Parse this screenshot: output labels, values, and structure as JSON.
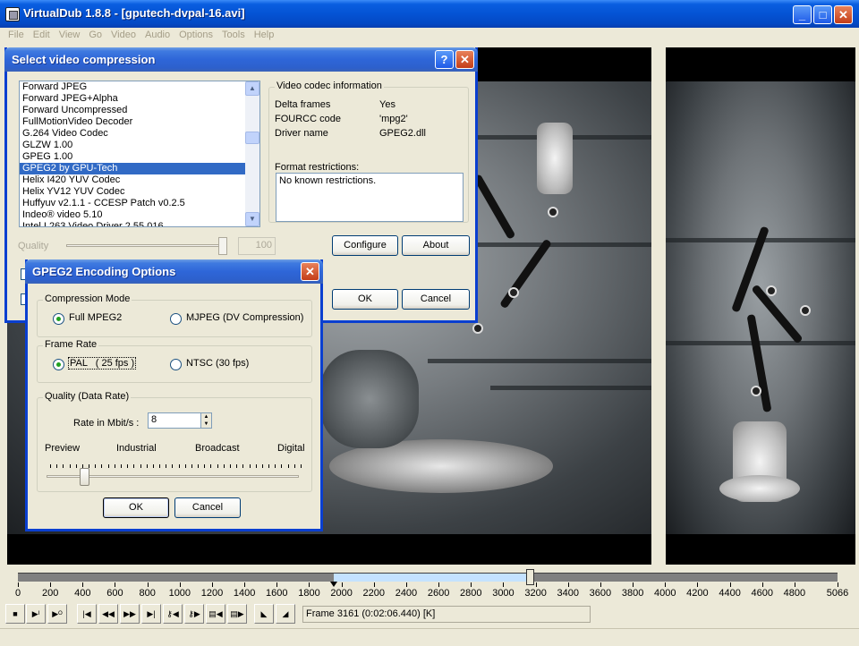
{
  "main_window": {
    "title": "VirtualDub 1.8.8 - [gputech-dvpal-16.avi]",
    "buttons": {
      "minimize": "_",
      "maximize": "□",
      "close": "✕"
    }
  },
  "menu": [
    "File",
    "Edit",
    "View",
    "Go",
    "Video",
    "Audio",
    "Options",
    "Tools",
    "Help"
  ],
  "compression_dialog": {
    "title": "Select video compression",
    "help_btn": "?",
    "close_btn": "✕",
    "codec_list": [
      "Forward  JPEG",
      "Forward JPEG+Alpha",
      "Forward Uncompressed",
      "FullMotionVideo Decoder",
      "G.264 Video Codec",
      "GLZW 1.00",
      "GPEG 1.00",
      "GPEG2 by GPU-Tech",
      "Helix I420 YUV Codec",
      "Helix YV12 YUV Codec",
      "Huffyuv v2.1.1 - CCESP Patch v0.2.5",
      "Indeo® video 5.10",
      "Intel I.263 Video Driver 2.55.016"
    ],
    "selected_index": 7,
    "info_group": "Video codec information",
    "info": [
      {
        "label": "Delta frames",
        "value": "Yes"
      },
      {
        "label": "FOURCC code",
        "value": "'mpg2'"
      },
      {
        "label": "Driver name",
        "value": "GPEG2.dll"
      }
    ],
    "format_restrictions_label": "Format restrictions:",
    "format_restrictions": "No known restrictions.",
    "quality_label": "Quality",
    "quality_value": "100",
    "configure_btn": "Configure",
    "about_btn": "About",
    "ok_btn": "OK",
    "cancel_btn": "Cancel"
  },
  "gpeg_dialog": {
    "title": "GPEG2 Encoding Options",
    "close_btn": "✕",
    "compression_mode": {
      "label": "Compression Mode",
      "options": [
        "Full MPEG2",
        "MJPEG (DV Compression)"
      ],
      "selected": 0
    },
    "frame_rate": {
      "label": "Frame Rate",
      "options": [
        "PAL   ( 25 fps )",
        "NTSC (30 fps)"
      ],
      "selected": 0
    },
    "quality": {
      "label": "Quality (Data Rate)",
      "rate_label": "Rate in Mbit/s :",
      "rate_value": "8",
      "scale_labels": [
        "Preview",
        "Industrial",
        "Broadcast",
        "Digital"
      ],
      "slider_level": 0.15
    },
    "ok_btn": "OK",
    "cancel_btn": "Cancel"
  },
  "timeline": {
    "ticks": [
      "0",
      "200",
      "400",
      "600",
      "800",
      "1000",
      "1200",
      "1400",
      "1600",
      "1800",
      "2000",
      "2200",
      "2400",
      "2600",
      "2800",
      "3000",
      "3200",
      "3400",
      "3600",
      "3800",
      "4000",
      "4200",
      "4400",
      "4600",
      "4800",
      "5066"
    ],
    "current_frame": 3161,
    "selection_start": 1950,
    "selection_end": 3161,
    "total_frames": 5066
  },
  "frame_status": "Frame 3161 (0:02:06.440) [K]",
  "toolbar_icons": [
    "stop-icon",
    "play-input-icon",
    "play-output-icon",
    "go-start-icon",
    "prev-frame-icon",
    "next-frame-icon",
    "go-end-icon",
    "prev-key-icon",
    "next-key-icon",
    "prev-scene-icon",
    "next-scene-icon",
    "mark-in-icon",
    "mark-out-icon"
  ],
  "toolbar_glyphs": [
    "■",
    "▶ᴵ",
    "▶ᴼ",
    "|◀",
    "◀◀",
    "▶▶",
    "▶|",
    "⚷◀",
    "⚷▶",
    "▤◀",
    "▤▶",
    "◣",
    "◢"
  ]
}
